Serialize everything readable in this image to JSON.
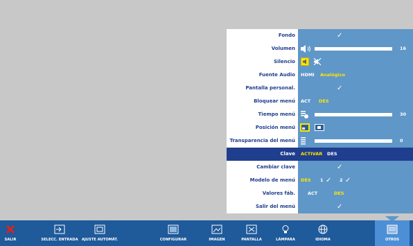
{
  "menu": {
    "items": [
      {
        "label": "Fondo"
      },
      {
        "label": "Volumen",
        "value": "16",
        "level": 0.77
      },
      {
        "label": "Silencio"
      },
      {
        "label": "Fuente Audio",
        "opt1": "HDMI",
        "opt2": "Analógico"
      },
      {
        "label": "Pantalla personal."
      },
      {
        "label": "Bloquear menú",
        "opt1": "ACT",
        "opt2": "DES"
      },
      {
        "label": "Tiempo menú",
        "value": "30",
        "level": 0.77
      },
      {
        "label": "Posición menú"
      },
      {
        "label": "Transparencia del menú",
        "value": "0",
        "level": 0.0
      },
      {
        "label": "Clave",
        "opt1": "ACTIVAR",
        "opt2": "DES"
      },
      {
        "label": "Cambiar clave"
      },
      {
        "label": "Modelo de menú",
        "opt1": "DES",
        "opt2": "1",
        "opt3": "2"
      },
      {
        "label": "Valores fáb.",
        "opt1": "ACT",
        "opt2": "DES"
      },
      {
        "label": "Salir del menú"
      }
    ],
    "selected_index": 9
  },
  "taskbar": {
    "tabs": [
      {
        "label": "SALIR",
        "icon": "close-icon"
      },
      {
        "label": "SELECC. ENTRADA",
        "icon": "input-icon"
      },
      {
        "label": "AJUSTE AUTOMÁT.",
        "icon": "auto-adjust-icon"
      },
      {
        "label": "CONFIGURAR",
        "icon": "setup-icon"
      },
      {
        "label": "IMAGEN",
        "icon": "picture-icon"
      },
      {
        "label": "PANTALLA",
        "icon": "display-icon"
      },
      {
        "label": "LÁMPARA",
        "icon": "lamp-icon"
      },
      {
        "label": "IDIOMA",
        "icon": "language-icon"
      },
      {
        "label": "OTROS",
        "icon": "others-icon"
      }
    ],
    "active_index": 8
  },
  "colors": {
    "label_text": "#1f3e8e",
    "panel": "#5f97c8",
    "highlight": "#ffe600",
    "taskbar": "#1f5a9a",
    "background": "#c8c8c8"
  }
}
